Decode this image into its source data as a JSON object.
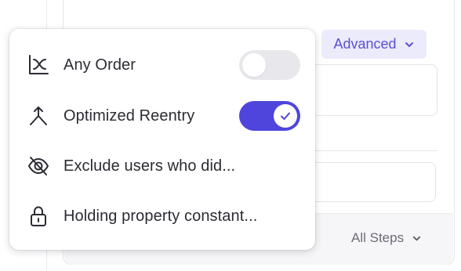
{
  "background": {
    "advanced_button": {
      "label": "Advanced",
      "icon": "chevron-down-icon"
    },
    "footer": {
      "all_steps_label": "All Steps",
      "icon": "chevron-down-icon"
    }
  },
  "menu": {
    "items": [
      {
        "label": "Any Order",
        "icon": "any-order-icon",
        "toggle": {
          "state": "off"
        }
      },
      {
        "label": "Optimized Reentry",
        "icon": "reentry-icon",
        "toggle": {
          "state": "on"
        }
      },
      {
        "label": "Exclude users who did...",
        "icon": "eye-off-icon"
      },
      {
        "label": "Holding property constant...",
        "icon": "lock-icon"
      }
    ]
  },
  "colors": {
    "accent": "#4f45dc",
    "accent_soft": "#ecebfb",
    "toggle_off": "#e8e8ec",
    "text": "#2b2b33"
  }
}
